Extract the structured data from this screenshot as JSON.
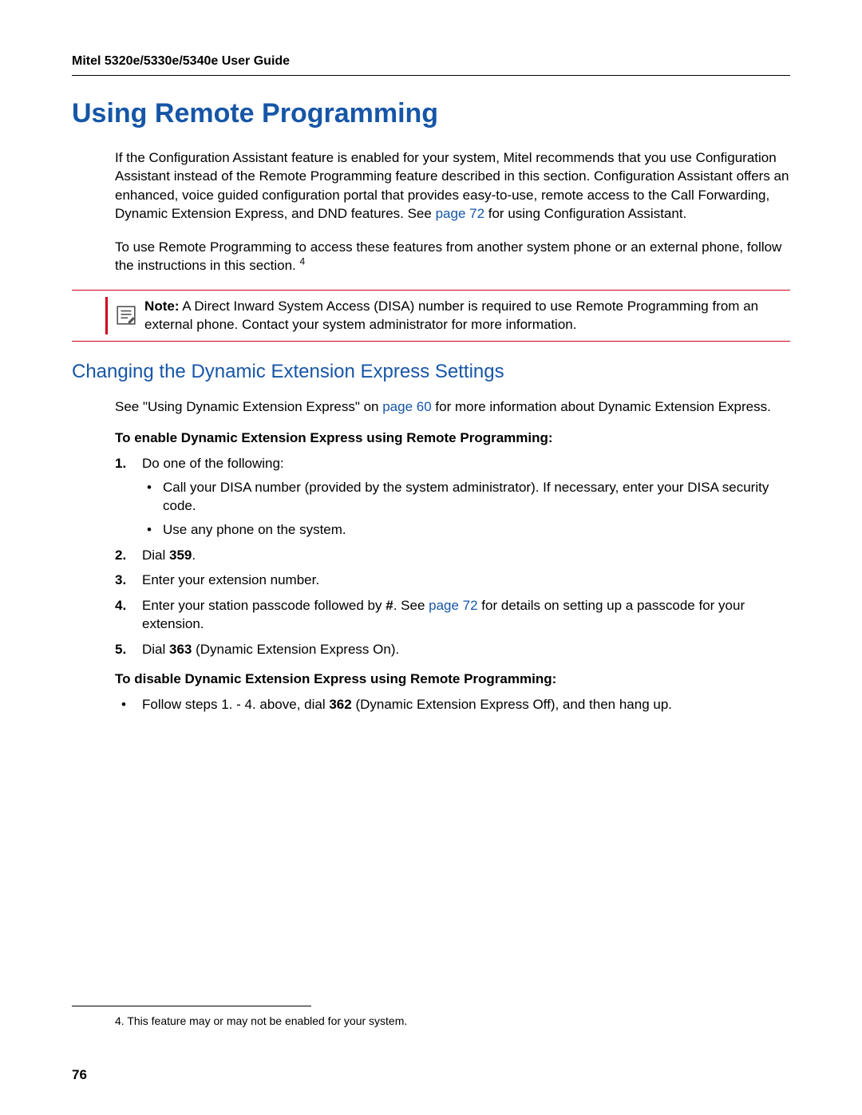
{
  "header": {
    "title": "Mitel 5320e/5330e/5340e User Guide"
  },
  "h1": "Using Remote Programming",
  "intro": {
    "p1a": "If the Configuration Assistant feature is enabled for your system, Mitel recommends that you use Configuration Assistant instead of the Remote Programming feature described in this section. Configuration Assistant offers an enhanced, voice guided configuration portal that provides easy-to-use, remote access to the Call Forwarding, Dynamic Extension Express, and DND features. See ",
    "p1link": "page 72",
    "p1b": " for using Configuration Assistant.",
    "p2a": "To use Remote Programming to access these features from another system phone or an external phone, follow the instructions in this section. ",
    "p2sup": "4"
  },
  "note": {
    "label": "Note:",
    "text": " A Direct Inward System Access (DISA) number is required to use Remote Programming from an external phone. Contact your system administrator for more information."
  },
  "h2": "Changing the Dynamic Extension Express Settings",
  "section2": {
    "p_a": "See \"Using Dynamic Extension Express\" on ",
    "p_link": "page 60",
    "p_b": " for more information about Dynamic Extension Express."
  },
  "enable": {
    "heading": "To enable Dynamic Extension Express using Remote Programming:",
    "step1": "Do one of the following:",
    "step1_bullets": [
      "Call your DISA number (provided by the system administrator). If necessary, enter your DISA security code.",
      "Use any phone on the system."
    ],
    "step2_a": "Dial ",
    "step2_b": "359",
    "step2_c": ".",
    "step3": "Enter your extension number.",
    "step4_a": "Enter your station passcode followed by ",
    "step4_b": "#",
    "step4_c": ". See ",
    "step4_link": "page 72",
    "step4_d": " for details on setting up a passcode for your extension.",
    "step5_a": "Dial ",
    "step5_b": "363",
    "step5_c": " (Dynamic Extension Express On)."
  },
  "disable": {
    "heading": "To disable Dynamic Extension Express using Remote Programming:",
    "bullet_a": "Follow steps 1. - 4. above, dial ",
    "bullet_b": "362",
    "bullet_c": " (Dynamic Extension Express Off), and then hang up."
  },
  "footnote": {
    "marker": "4.",
    "text": "  This feature may or may not be enabled for your system."
  },
  "page_number": "76"
}
